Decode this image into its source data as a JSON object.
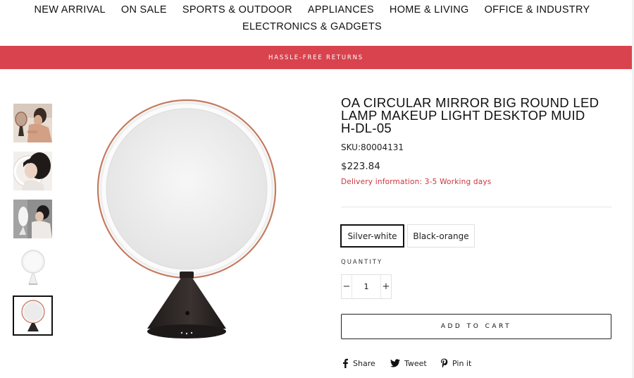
{
  "nav": {
    "row1": [
      "NEW ARRIVAL",
      "ON SALE",
      "SPORTS & OUTDOOR",
      "APPLIANCES",
      "HOME & LIVING",
      "OFFICE & INDUSTRY"
    ],
    "row2": [
      "ELECTRONICS & GADGETS"
    ]
  },
  "announcement": {
    "text": "HASSLE-FREE RETURNS",
    "background": "#d9434e"
  },
  "gallery": {
    "thumbnails": [
      "lifestyle-woman-with-mirror",
      "woman-portrait-with-ring-light",
      "woman-at-mirror-side-view",
      "white-mirror-product",
      "black-mirror-product"
    ],
    "selected_index": 4
  },
  "product": {
    "title": "OA CIRCULAR MIRROR BIG ROUND LED LAMP MAKEUP LIGHT DESKTOP MUID H-DL-05",
    "sku": "SKU:80004131",
    "price": "$223.84",
    "delivery": "Delivery information: 3-5 Working days",
    "variants": [
      "Silver-white",
      "Black-orange"
    ],
    "selected_variant": "Silver-white",
    "quantity_label": "QUANTITY",
    "quantity_minus": "−",
    "quantity_plus": "+",
    "quantity_value": "1",
    "add_to_cart": "ADD TO CART"
  },
  "share": [
    {
      "label": "Share",
      "icon": "facebook-icon"
    },
    {
      "label": "Tweet",
      "icon": "twitter-icon"
    },
    {
      "label": "Pin it",
      "icon": "pinterest-icon"
    }
  ],
  "colors": {
    "accent": "#d9434e",
    "delivery_text": "#c9343f",
    "mirror_ring": "#c47a5e",
    "base": "#2b2523"
  }
}
